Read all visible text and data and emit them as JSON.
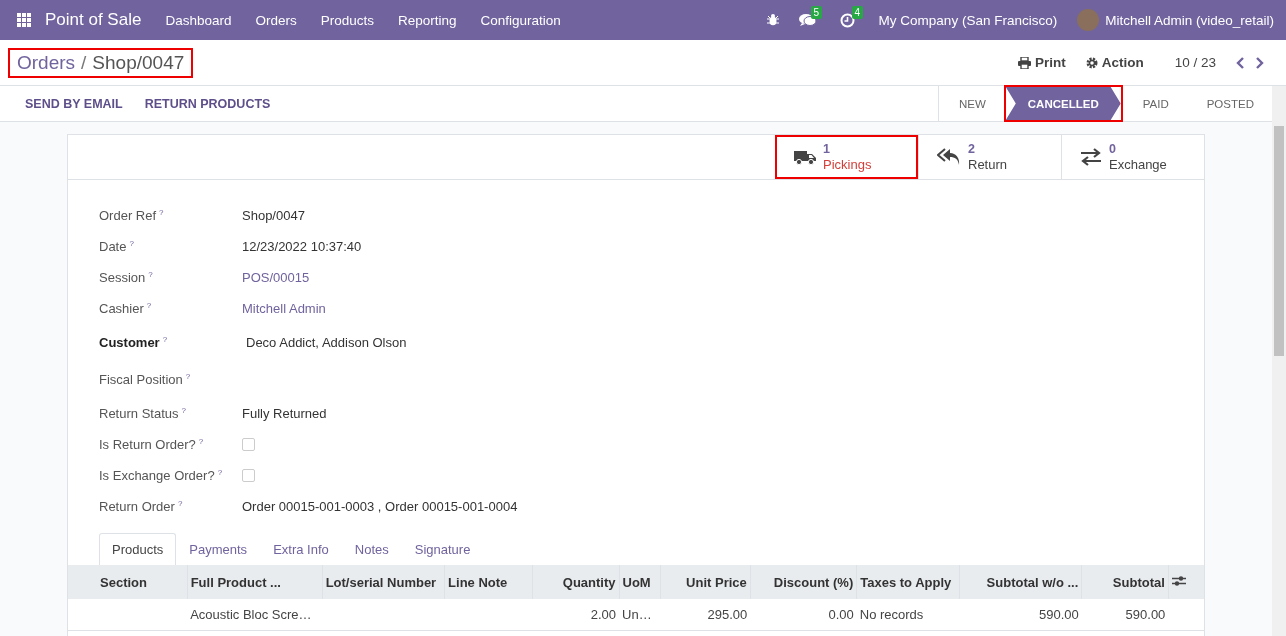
{
  "navbar": {
    "app_name": "Point of Sale",
    "menu": [
      "Dashboard",
      "Orders",
      "Products",
      "Reporting",
      "Configuration"
    ],
    "messages_count": "5",
    "activities_count": "4",
    "company": "My Company (San Francisco)",
    "user": "Mitchell Admin (video_retail)"
  },
  "breadcrumb": {
    "parent": "Orders",
    "separator": "/",
    "current": "Shop/0047",
    "highlighted": true
  },
  "control_panel": {
    "print": "Print",
    "action": "Action",
    "pager": "10 / 23"
  },
  "actions": [
    "SEND BY EMAIL",
    "RETURN PRODUCTS"
  ],
  "status_steps": [
    {
      "label": "NEW",
      "selected": false,
      "highlighted": false
    },
    {
      "label": "CANCELLED",
      "selected": true,
      "highlighted": true
    },
    {
      "label": "PAID",
      "selected": false,
      "highlighted": false
    },
    {
      "label": "POSTED",
      "selected": false,
      "highlighted": false
    }
  ],
  "smart_buttons": [
    {
      "kind": "truck",
      "count": "1",
      "label": "Pickings",
      "highlighted": true
    },
    {
      "kind": "reply",
      "count": "2",
      "label": "Return",
      "highlighted": false
    },
    {
      "kind": "exchange",
      "count": "0",
      "label": "Exchange",
      "highlighted": false
    }
  ],
  "fields": [
    {
      "label": "Order Ref",
      "kind": "text",
      "value": "Shop/0047"
    },
    {
      "label": "Date",
      "kind": "text",
      "value": "12/23/2022 10:37:40"
    },
    {
      "label": "Session",
      "kind": "link",
      "value": "POS/00015"
    },
    {
      "label": "Cashier",
      "kind": "link",
      "value": "Mitchell Admin"
    },
    {
      "label": "Customer",
      "kind": "required",
      "value": "Deco Addict, Addison Olson"
    },
    {
      "label": "Fiscal Position",
      "kind": "empty"
    },
    {
      "label": "Return Status",
      "kind": "text",
      "value": "Fully Returned"
    },
    {
      "label": "Is Return Order?",
      "kind": "checkbox",
      "checked": false
    },
    {
      "label": "Is Exchange Order?",
      "kind": "checkbox",
      "checked": false
    },
    {
      "label": "Return Order",
      "kind": "text",
      "value": "Order 00015-001-0003 , Order 00015-001-0004"
    }
  ],
  "help_mark": "?",
  "tabs": [
    {
      "label": "Products",
      "selected": true
    },
    {
      "label": "Payments",
      "selected": false
    },
    {
      "label": "Extra Info",
      "selected": false
    },
    {
      "label": "Notes",
      "selected": false
    },
    {
      "label": "Signature",
      "selected": false
    }
  ],
  "table": {
    "columns": [
      {
        "label": "Section",
        "kind": "text"
      },
      {
        "label": "Full Product ...",
        "kind": "text"
      },
      {
        "label": "Lot/serial Number",
        "kind": "text"
      },
      {
        "label": "Line Note",
        "kind": "text"
      },
      {
        "label": "Quantity",
        "kind": "number"
      },
      {
        "label": "UoM",
        "kind": "text"
      },
      {
        "label": "Unit Price",
        "kind": "number"
      },
      {
        "label": "Discount (%)",
        "kind": "number"
      },
      {
        "label": "Taxes to Apply",
        "kind": "text"
      },
      {
        "label": "Subtotal w/o ...",
        "kind": "number"
      },
      {
        "label": "Subtotal",
        "kind": "number"
      }
    ],
    "rows": [
      [
        "",
        "Acoustic Bloc Scre…",
        "",
        "",
        "2.00",
        "Un…",
        "295.00",
        "0.00",
        "No records",
        "590.00",
        "590.00"
      ]
    ]
  }
}
